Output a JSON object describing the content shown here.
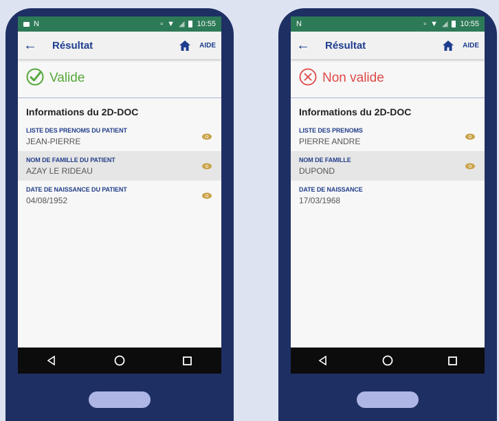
{
  "phones": [
    {
      "status_bar": {
        "time": "10:55",
        "left_icons": [
          "image-icon",
          "n-icon"
        ]
      },
      "app_bar": {
        "back_label": "←",
        "title": "Résultat",
        "aide": "AIDE"
      },
      "result": {
        "label": "Valide",
        "state": "valid",
        "icon": "check-circle-icon",
        "color": "#55a83a"
      },
      "section_title": "Informations du 2D-DOC",
      "fields": [
        {
          "label": "LISTE DES PRENOMS DU PATIENT",
          "value": "JEAN-PIERRE"
        },
        {
          "label": "NOM DE FAMILLE DU PATIENT",
          "value": "AZAY LE RIDEAU"
        },
        {
          "label": "DATE DE NAISSANCE DU PATIENT",
          "value": "04/08/1952"
        }
      ]
    },
    {
      "status_bar": {
        "time": "10:55",
        "left_icons": [
          "n-icon"
        ]
      },
      "app_bar": {
        "back_label": "←",
        "title": "Résultat",
        "aide": "AIDE"
      },
      "result": {
        "label": "Non valide",
        "state": "invalid",
        "icon": "x-circle-icon",
        "color": "#e04848"
      },
      "section_title": "Informations du 2D-DOC",
      "fields": [
        {
          "label": "LISTE DES PRENOMS",
          "value": "PIERRE ANDRE"
        },
        {
          "label": "NOM DE FAMILLE",
          "value": "DUPOND"
        },
        {
          "label": "DATE DE NAISSANCE",
          "value": "17/03/1968"
        }
      ]
    }
  ],
  "colors": {
    "frame": "#1e2f63",
    "status_bar": "#2d7a57",
    "accent": "#1e3d8f",
    "eye": "#c9a24a"
  }
}
